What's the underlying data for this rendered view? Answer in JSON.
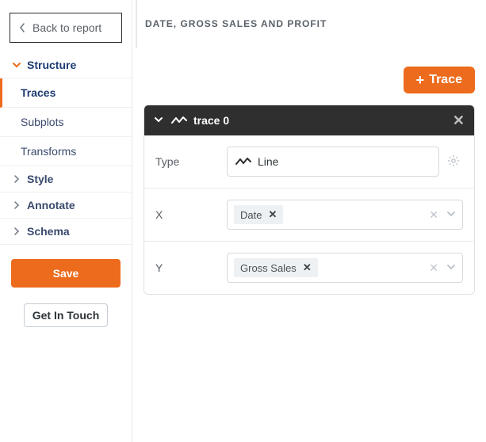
{
  "sidebar": {
    "back_label": "Back to report",
    "sections": {
      "structure": {
        "label": "Structure",
        "expanded": true
      },
      "style": {
        "label": "Style"
      },
      "annotate": {
        "label": "Annotate"
      },
      "schema": {
        "label": "Schema"
      }
    },
    "structure_items": [
      {
        "label": "Traces",
        "active": true
      },
      {
        "label": "Subplots",
        "active": false
      },
      {
        "label": "Transforms",
        "active": false
      }
    ],
    "save_label": "Save",
    "get_in_touch_label": "Get In Touch"
  },
  "header": {
    "title": "DATE, GROSS SALES AND PROFIT"
  },
  "actions": {
    "add_trace_label": "Trace"
  },
  "trace_panel": {
    "title": "trace 0",
    "fields": {
      "type": {
        "label": "Type",
        "value": "Line"
      },
      "x": {
        "label": "X",
        "tag": "Date"
      },
      "y": {
        "label": "Y",
        "tag": "Gross Sales"
      }
    }
  },
  "colors": {
    "accent": "#ed6b1c",
    "panel_header": "#2f2f2f"
  }
}
